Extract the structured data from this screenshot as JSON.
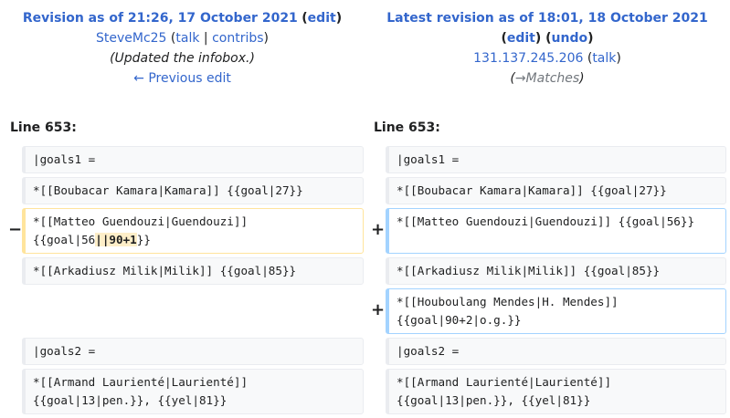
{
  "left_header": {
    "title": "Revision as of 21:26, 17 October 2021",
    "edit": "edit",
    "user": "SteveMc25",
    "talk": "talk",
    "contribs": "contribs",
    "summary": "(Updated the infobox.)",
    "prev": "← Previous edit"
  },
  "right_header": {
    "title": "Latest revision as of 18:01, 18 October 2021",
    "edit": "edit",
    "undo": "undo",
    "ip": "131.137.245.206",
    "talk": "talk",
    "summary_arrow": "→",
    "summary_text": "Matches"
  },
  "line_label_left": "Line 653:",
  "line_label_right": "Line 653:",
  "markers": {
    "minus": "−",
    "plus": "+"
  },
  "left": {
    "r1": "|goals1 =",
    "r2": "*[[Boubacar Kamara|Kamara]] {{goal|27}}",
    "r3a": "*[[Matteo Guendouzi|Guendouzi]]",
    "r3b_pre": "{{goal|56",
    "r3b_hl": "||90+1",
    "r3b_post": "}}",
    "r4": "*[[Arkadiusz Milik|Milik]] {{goal|85}}",
    "r6": "|goals2 =",
    "r7a": "*[[Armand Laurienté|Laurienté]]",
    "r7b": "{{goal|13|pen.}}, {{yel|81}}"
  },
  "right": {
    "r1": "|goals1 =",
    "r2": "*[[Boubacar Kamara|Kamara]] {{goal|27}}",
    "r3": "*[[Matteo Guendouzi|Guendouzi]] {{goal|56}}",
    "r4": "*[[Arkadiusz Milik|Milik]] {{goal|85}}",
    "r5a": "*[[Houboulang Mendes|H. Mendes]]",
    "r5b": "{{goal|90+2|o.g.}}",
    "r6": "|goals2 =",
    "r7a": "*[[Armand Laurienté|Laurienté]]",
    "r7b": "{{goal|13|pen.}}, {{yel|81}}"
  }
}
